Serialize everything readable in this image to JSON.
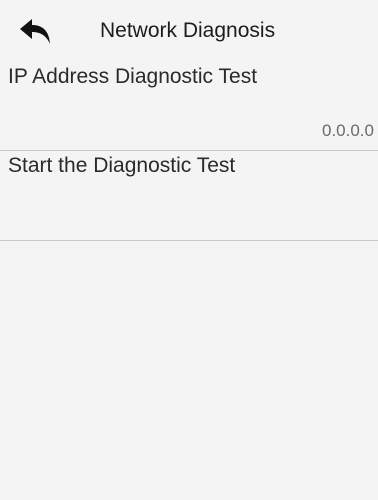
{
  "header": {
    "back_icon": "back-arrow-icon",
    "title": "Network Diagnosis"
  },
  "items": [
    {
      "label": "IP Address Diagnostic Test",
      "value": "0.0.0.0"
    },
    {
      "label": "Start the Diagnostic Test"
    }
  ],
  "colors": {
    "background": "#f4f4f4",
    "divider": "#c9c9c9",
    "text": "#2a2a2a",
    "value_text": "#6b6b6b"
  }
}
